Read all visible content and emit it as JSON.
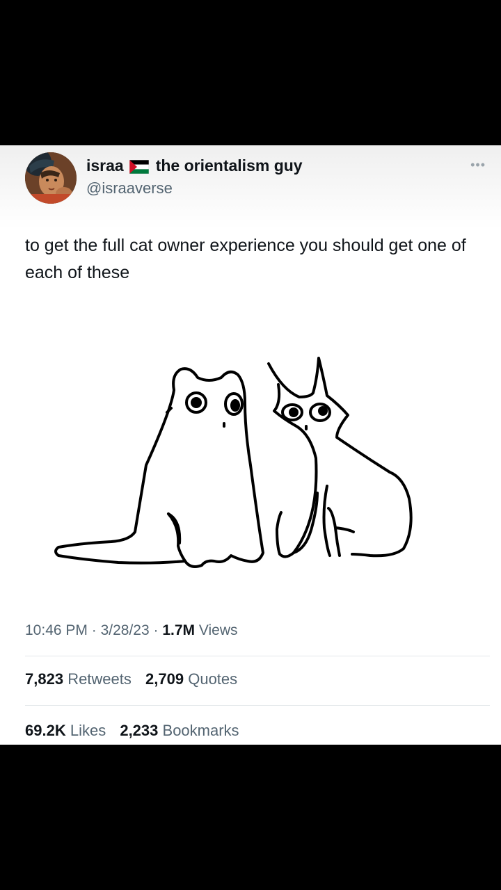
{
  "author": {
    "display_name": "israa",
    "display_name_suffix": "the orientalism guy",
    "flag_icon": "palestine-flag-icon",
    "handle": "@israaverse"
  },
  "more_icon": "more-horizontal-icon",
  "tweet": {
    "text": "to get the full cat owner experience you should get one of each of these"
  },
  "meta": {
    "time": "10:46 PM",
    "separator": "·",
    "date": "3/28/23",
    "views_count": "1.7M",
    "views_label": "Views"
  },
  "stats": {
    "retweets_count": "7,823",
    "retweets_label": "Retweets",
    "quotes_count": "2,709",
    "quotes_label": "Quotes",
    "likes_count": "69.2K",
    "likes_label": "Likes",
    "bookmarks_count": "2,233",
    "bookmarks_label": "Bookmarks"
  },
  "colors": {
    "text_primary": "#0f1419",
    "text_secondary": "#536471",
    "divider": "#e3e7ea",
    "flag_red": "#ce1126",
    "flag_green": "#007a3d"
  }
}
